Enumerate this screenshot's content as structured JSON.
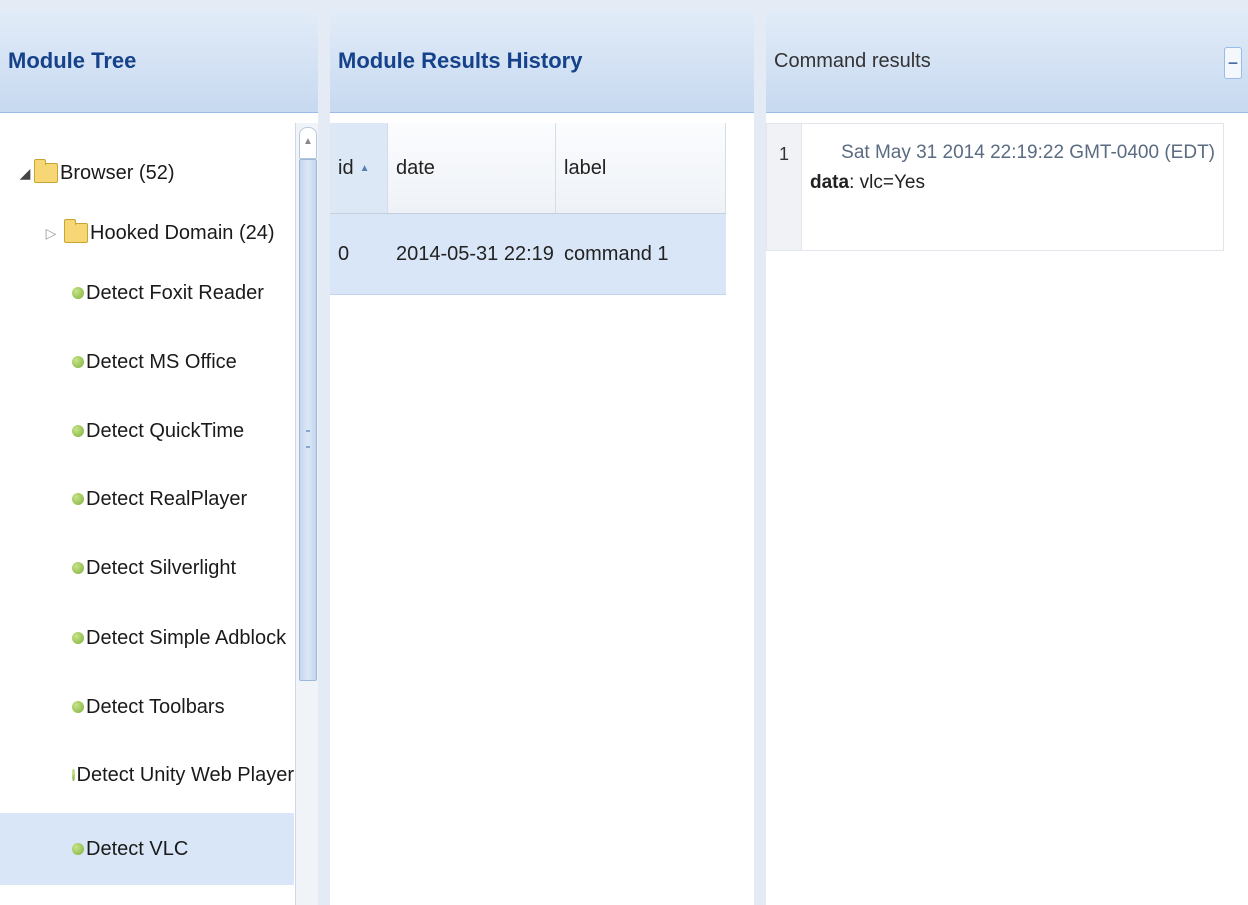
{
  "module_tree": {
    "title": "Module Tree",
    "items": [
      {
        "label": "Browser (52)",
        "type": "folder",
        "expanded": true,
        "level": 0
      },
      {
        "label": "Hooked Domain (24)",
        "type": "folder",
        "expanded": false,
        "level": 1
      },
      {
        "label": "Detect Foxit Reader",
        "type": "leaf",
        "level": 1
      },
      {
        "label": "Detect MS Office",
        "type": "leaf",
        "level": 1
      },
      {
        "label": "Detect QuickTime",
        "type": "leaf",
        "level": 1
      },
      {
        "label": "Detect RealPlayer",
        "type": "leaf",
        "level": 1
      },
      {
        "label": "Detect Silverlight",
        "type": "leaf",
        "level": 1
      },
      {
        "label": "Detect Simple Adblock",
        "type": "leaf",
        "level": 1
      },
      {
        "label": "Detect Toolbars",
        "type": "leaf",
        "level": 1
      },
      {
        "label": "Detect Unity Web Player",
        "type": "leaf",
        "level": 1
      },
      {
        "label": "Detect VLC",
        "type": "leaf",
        "level": 1,
        "selected": true
      }
    ]
  },
  "history": {
    "title": "Module Results History",
    "columns": [
      {
        "label": "id",
        "sorted": "asc"
      },
      {
        "label": "date"
      },
      {
        "label": "label"
      }
    ],
    "rows": [
      {
        "id": "0",
        "date": "2014-05-31 22:19",
        "label": "command 1"
      }
    ]
  },
  "results": {
    "title": "Command results",
    "collapse_icon": "minus-icon",
    "entries": [
      {
        "number": "1",
        "date": "Sat May 31 2014 22:19:22 GMT-0400 (EDT)",
        "data_label": "data",
        "data_value": ": vlc=Yes"
      }
    ]
  },
  "colors": {
    "header_text": "#15428b",
    "header_bg": "#c7d9f0",
    "selected_row": "#d9e6f7",
    "leaf_icon": "#7fae3a",
    "folder_icon": "#f7d775"
  }
}
